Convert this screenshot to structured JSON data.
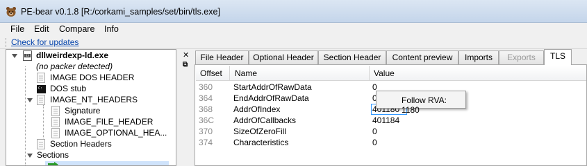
{
  "window": {
    "title": "PE-bear v0.1.8 [R:/corkami_samples/set/bin/tls.exe]"
  },
  "menu": [
    "File",
    "Edit",
    "Compare",
    "Info"
  ],
  "update_link": "Check for updates",
  "tree": {
    "root_label": "dllweirdexp-ld.exe",
    "packer_note": "(no packer detected)",
    "items": {
      "dos_header": "IMAGE DOS HEADER",
      "dos_stub": "DOS stub",
      "nt_headers": "IMAGE_NT_HEADERS",
      "signature": "Signature",
      "file_header": "IMAGE_FILE_HEADER",
      "optional_header": "IMAGE_OPTIONAL_HEA...",
      "section_headers": "Section Headers",
      "sections": "Sections"
    }
  },
  "tabs": [
    {
      "label": "File Header"
    },
    {
      "label": "Optional Header"
    },
    {
      "label": "Section Header"
    },
    {
      "label": "Content preview"
    },
    {
      "label": "Imports"
    },
    {
      "label": "Exports"
    },
    {
      "label": "TLS"
    }
  ],
  "table": {
    "headers": [
      "Offset",
      "Name",
      "Value"
    ],
    "rows": [
      {
        "offset": "360",
        "name": "StartAddrOfRawData",
        "value": "0"
      },
      {
        "offset": "364",
        "name": "EndAddrOfRawData",
        "value": "0"
      },
      {
        "offset": "368",
        "name": "AddrOfIndex",
        "value": "401180"
      },
      {
        "offset": "36C",
        "name": "AddrOfCallbacks",
        "value": "401184"
      },
      {
        "offset": "370",
        "name": "SizeOfZeroFill",
        "value": "0"
      },
      {
        "offset": "374",
        "name": "Characteristics",
        "value": "0"
      }
    ]
  },
  "context_menu": {
    "item": "Follow RVA: 1180"
  },
  "colors": {
    "link": "#0645ad",
    "offset_text": "#8a8a8a",
    "edit_border": "#3399ff",
    "selection": "#cfe3fb"
  }
}
